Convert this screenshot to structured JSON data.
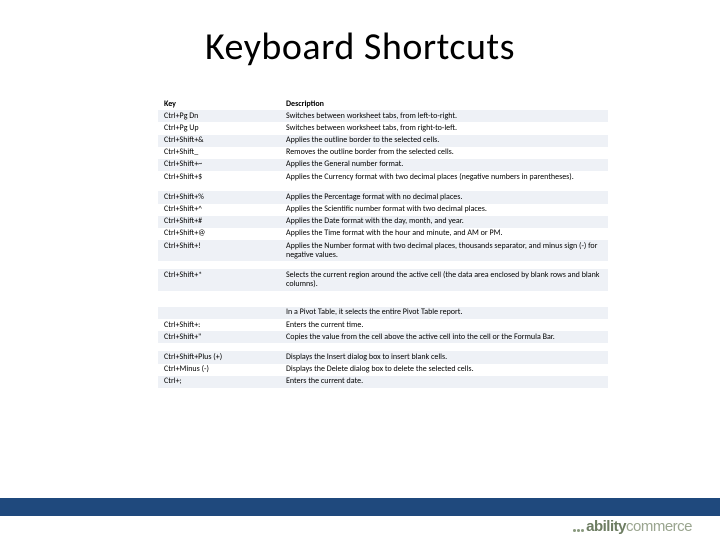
{
  "title": "Keyboard Shortcuts",
  "headers": {
    "key": "Key",
    "desc": "Description"
  },
  "rows": [
    {
      "key": "Ctrl+Pg Dn",
      "desc": "Switches between worksheet tabs, from left-to-right."
    },
    {
      "key": "Ctrl+Pg Up",
      "desc": "Switches between worksheet tabs, from right-to-left."
    },
    {
      "key": "Ctrl+Shift+&",
      "desc": "Applies the outline border to the selected cells."
    },
    {
      "key": "Ctrl+Shift_",
      "desc": "Removes the outline border from the selected cells."
    },
    {
      "key": "Ctrl+Shift+~",
      "desc": "Applies the General number format."
    },
    {
      "key": "Ctrl+Shift+$",
      "desc": "Applies the Currency format with two decimal places (negative numbers in parentheses)."
    },
    {
      "key": "Ctrl+Shift+%",
      "desc": "Applies the Percentage format with no decimal places."
    },
    {
      "key": "Ctrl+Shift+^",
      "desc": "Applies the Scientific number format with two decimal places."
    },
    {
      "key": "Ctrl+Shift+#",
      "desc": "Applies the Date format with the day, month, and year."
    },
    {
      "key": "Ctrl+Shift+@",
      "desc": "Applies the Time format with the hour and minute, and AM or PM."
    },
    {
      "key": "Ctrl+Shift+!",
      "desc": "Applies the Number format with two decimal places, thousands separator, and minus sign (-) for negative values."
    },
    {
      "key": "Ctrl+Shift+*",
      "desc": "Selects the current region around the active cell (the data area enclosed by blank rows and blank columns)."
    },
    {
      "key": "",
      "desc": "In a Pivot Table, it selects the entire Pivot Table report."
    },
    {
      "key": "Ctrl+Shift+:",
      "desc": "Enters the current time."
    },
    {
      "key": "Ctrl+Shift+\"",
      "desc": "Copies the value from the cell above the active cell into the cell or the Formula Bar."
    },
    {
      "key": "Ctrl+Shift+Plus (+)",
      "desc": "Displays the Insert dialog box to insert blank cells."
    },
    {
      "key": "Ctrl+Minus (-)",
      "desc": "Displays the Delete dialog box to delete the selected cells."
    },
    {
      "key": "Ctrl+;",
      "desc": "Enters the current date."
    }
  ],
  "spacer_after": [
    5,
    10,
    11,
    11,
    14
  ],
  "logo": {
    "part1": "ability",
    "part2": "commerce"
  }
}
